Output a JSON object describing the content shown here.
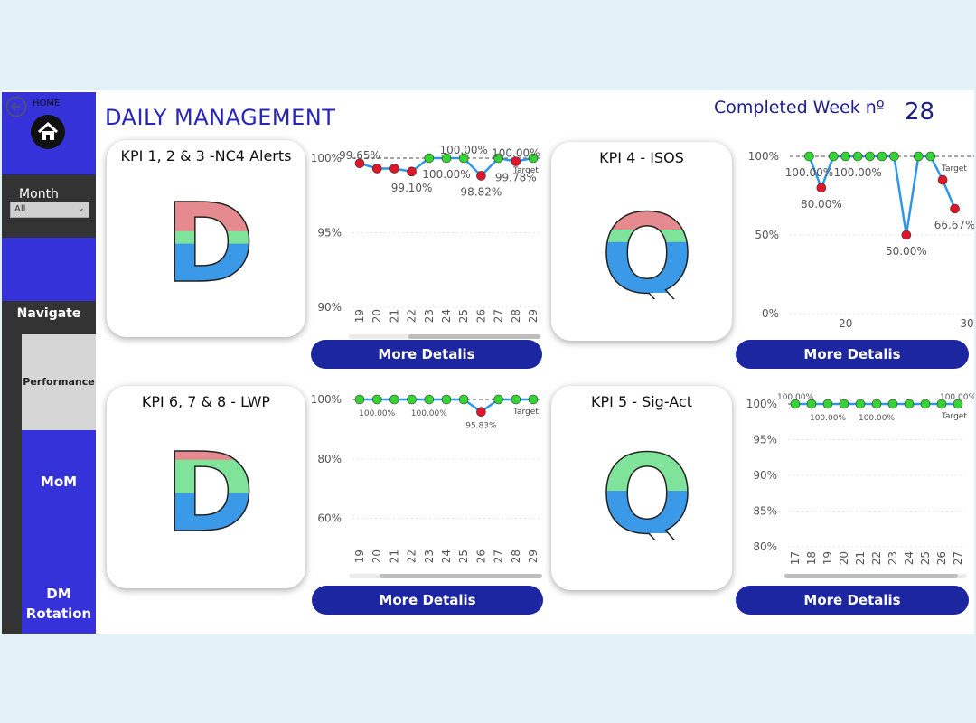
{
  "header": {
    "title": "DAILY MANAGEMENT",
    "week_label": "Completed Week nº",
    "week_number": "28"
  },
  "sidebar": {
    "home_label": "HOME",
    "month_label": "Month",
    "month_value": "All",
    "navigate_label": "Navigate",
    "items": [
      {
        "label": "Performance"
      },
      {
        "label": "MoM"
      },
      {
        "label": "DM\nRotation"
      }
    ]
  },
  "colors": {
    "sidebar": "#3432d8",
    "button": "#1c26a0",
    "line": "#2f96e8",
    "point_ok": "#33d433",
    "point_bad": "#e0162a",
    "letter_green": "#7fe39a",
    "letter_red": "#e58a8f",
    "letter_blue": "#3a9ae8"
  },
  "cards": [
    {
      "title": "KPI 1, 2 & 3 -NC4 Alerts",
      "letter": "D",
      "button": "More Detalis",
      "icon": "letter-d-status-icon"
    },
    {
      "title": "KPI 4 - ISOS",
      "letter": "Q",
      "button": "More Detalis",
      "icon": "letter-q-status-icon"
    },
    {
      "title": "KPI 6, 7 & 8  - LWP",
      "letter": "D",
      "button": "More Detalis",
      "icon": "letter-d-status-icon"
    },
    {
      "title": "KPI 5 - Sig-Act",
      "letter": "Q",
      "button": "More Detalis",
      "icon": "letter-q-status-icon"
    }
  ],
  "chart_data": [
    {
      "type": "line",
      "target_label": "Target",
      "target": 100,
      "x": [
        19,
        20,
        21,
        22,
        23,
        24,
        25,
        26,
        27,
        28,
        29
      ],
      "values": [
        99.65,
        99.3,
        99.3,
        99.1,
        100,
        100,
        100,
        98.82,
        100,
        99.78,
        100
      ],
      "ylim": [
        90,
        100
      ],
      "yticks": [
        100,
        95,
        90
      ],
      "ytick_labels": [
        "100%",
        "95%",
        "90%"
      ],
      "data_labels": [
        {
          "i": 0,
          "text": "99.65%",
          "pos": "above"
        },
        {
          "i": 3,
          "text": "99.10%",
          "pos": "below"
        },
        {
          "i": 5,
          "text": "100.00%",
          "pos": "below"
        },
        {
          "i": 6,
          "text": "100.00%",
          "pos": "above"
        },
        {
          "i": 7,
          "text": "98.82%",
          "pos": "below"
        },
        {
          "i": 9,
          "text": "99.78%",
          "pos": "below"
        },
        {
          "i": 9,
          "text": "100.00%",
          "pos": "above"
        }
      ]
    },
    {
      "type": "line",
      "target_label": "Target",
      "target": 100,
      "x": [
        17,
        18,
        19,
        20,
        21,
        22,
        23,
        24,
        25,
        26,
        27,
        28,
        29
      ],
      "values": [
        100,
        80,
        100,
        100,
        100,
        100,
        100,
        100,
        50,
        100,
        100,
        85,
        66.67
      ],
      "ylim": [
        0,
        100
      ],
      "yticks": [
        100,
        50,
        0
      ],
      "ytick_labels": [
        "100%",
        "50%",
        "0%"
      ],
      "xtick_labels": [
        {
          "x": 20,
          "text": "20"
        },
        {
          "x": 30,
          "text": "30"
        }
      ],
      "xrange": [
        16,
        30
      ],
      "data_labels": [
        {
          "i": 0,
          "text": "100.00%",
          "pos": "below"
        },
        {
          "i": 1,
          "text": "80.00%",
          "pos": "below"
        },
        {
          "i": 4,
          "text": "100.00%",
          "pos": "below"
        },
        {
          "i": 8,
          "text": "50.00%",
          "pos": "below"
        },
        {
          "i": 12,
          "text": "66.67%",
          "pos": "below"
        }
      ]
    },
    {
      "type": "line",
      "target_label": "Target",
      "target": 100,
      "x": [
        19,
        20,
        21,
        22,
        23,
        24,
        25,
        26,
        27,
        28,
        29
      ],
      "values": [
        100,
        100,
        100,
        100,
        100,
        100,
        100,
        95.83,
        100,
        100,
        100
      ],
      "ylim": [
        55,
        100
      ],
      "yticks": [
        100,
        80,
        60
      ],
      "ytick_labels": [
        "100%",
        "80%",
        "60%"
      ],
      "data_labels": [
        {
          "i": 1,
          "text": "100.00%",
          "pos": "below"
        },
        {
          "i": 4,
          "text": "100.00%",
          "pos": "below"
        },
        {
          "i": 7,
          "text": "95.83%",
          "pos": "below"
        }
      ]
    },
    {
      "type": "line",
      "target_label": "Target",
      "target": 100,
      "x": [
        17,
        18,
        19,
        20,
        21,
        22,
        23,
        24,
        25,
        26,
        27
      ],
      "values": [
        100,
        100,
        100,
        100,
        100,
        100,
        100,
        100,
        100,
        100,
        100
      ],
      "ylim": [
        80,
        100
      ],
      "yticks": [
        100,
        95,
        90,
        85,
        80
      ],
      "ytick_labels": [
        "100%",
        "95%",
        "90%",
        "85%",
        "80%"
      ],
      "data_labels": [
        {
          "i": 0,
          "text": "100.00%",
          "pos": "above"
        },
        {
          "i": 2,
          "text": "100.00%",
          "pos": "below"
        },
        {
          "i": 5,
          "text": "100.00%",
          "pos": "below"
        },
        {
          "i": 10,
          "text": "100.00%",
          "pos": "above"
        }
      ]
    }
  ]
}
